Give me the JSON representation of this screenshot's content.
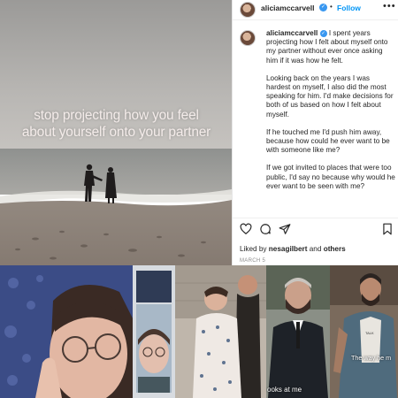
{
  "overlay": {
    "line1": "stop projecting how you feel",
    "line2": "about yourself onto your partner"
  },
  "post": {
    "username": "aliciamccarvell",
    "follow_label": "Follow",
    "dot": "•",
    "more": "•••",
    "caption_paragraphs": [
      "I spent years projecting how I felt about myself onto my partner without ever once asking him if it was how he felt.",
      "Looking back on the years I was hardest on myself, I also did the most speaking for him. I'd make decisions for both of us based on how I felt about myself.",
      "If he touched me I'd push him away, because how could he ever want to be with someone like me?",
      "If we got invited to places that were too public, I'd say no because why would he ever want to be seen with me?"
    ],
    "likes_prefix": "Liked by",
    "likes_user": "nesagilbert",
    "likes_and": "and",
    "likes_others": "others",
    "date": "MARCH 5"
  },
  "icons": [
    "heart-icon",
    "comment-icon",
    "share-icon",
    "bookmark-icon",
    "verified-badge-icon"
  ],
  "video_captions": {
    "tile4": "ooks at me",
    "tile5": "The way he m"
  },
  "colors": {
    "accent": "#0095f6",
    "badge": "#3897f0",
    "text": "#262626",
    "muted": "#8e8e8e"
  }
}
